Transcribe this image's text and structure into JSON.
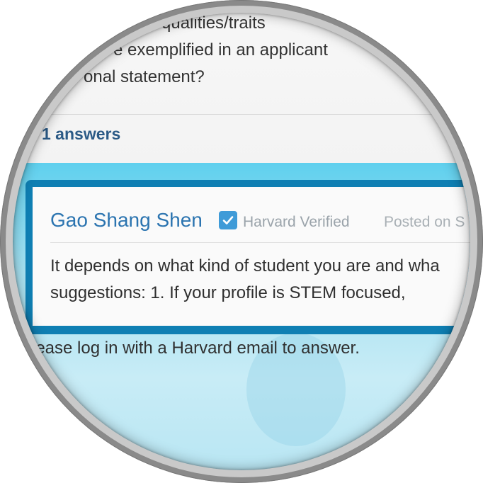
{
  "question": {
    "lines": [
      "qualities/traits",
      "e exemplified in an applicant",
      "onal statement?"
    ]
  },
  "answers_count": "1 answers",
  "answer": {
    "author": "Gao Shang Shen",
    "verified_label": "Harvard Verified",
    "posted_label": "Posted on S",
    "text_lines": [
      "It depends on what kind of student you are and wha",
      "suggestions: 1. If your profile is STEM focused,"
    ]
  },
  "login_note": "lease log in with a Harvard email to answer.",
  "colors": {
    "author_blue": "#2b74b0",
    "answers_count": "#2b5a86",
    "card_border": "#0f7fb3",
    "verified_icon": "#3f9bd8"
  },
  "icons": {
    "verified": "check-square-icon"
  }
}
